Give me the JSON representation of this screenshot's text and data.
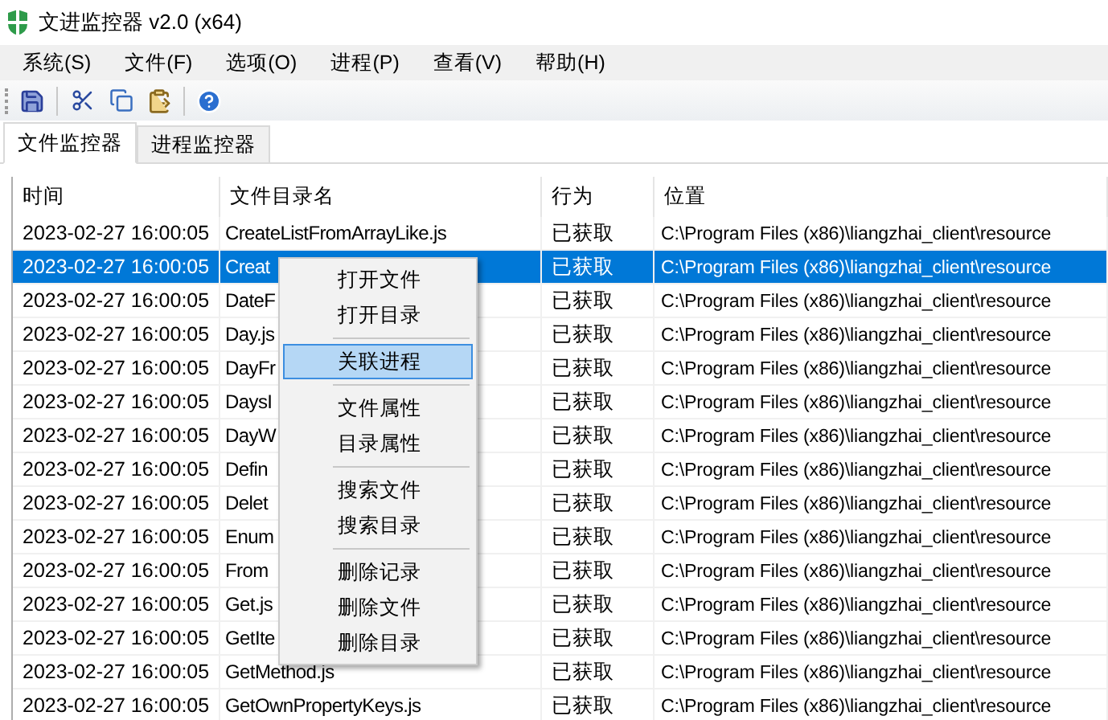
{
  "window": {
    "title": "文进监控器 v2.0 (x64)"
  },
  "menu_bar": [
    "系统(S)",
    "文件(F)",
    "选项(O)",
    "进程(P)",
    "查看(V)",
    "帮助(H)"
  ],
  "tabs": [
    {
      "label": "文件监控器",
      "selected": true
    },
    {
      "label": "进程监控器",
      "selected": false
    }
  ],
  "table": {
    "columns": [
      "时间",
      "文件目录名",
      "行为",
      "位置"
    ],
    "rows": [
      {
        "time": "2023-02-27 16:00:05",
        "name": "CreateListFromArrayLike.js",
        "action": "已获取",
        "location": "C:\\Program Files (x86)\\liangzhai_client\\resource",
        "selected": false
      },
      {
        "time": "2023-02-27 16:00:05",
        "name": "Creat",
        "action": "已获取",
        "location": "C:\\Program Files (x86)\\liangzhai_client\\resource",
        "selected": true
      },
      {
        "time": "2023-02-27 16:00:05",
        "name": "DateF",
        "action": "已获取",
        "location": "C:\\Program Files (x86)\\liangzhai_client\\resource",
        "selected": false
      },
      {
        "time": "2023-02-27 16:00:05",
        "name": "Day.js",
        "action": "已获取",
        "location": "C:\\Program Files (x86)\\liangzhai_client\\resource",
        "selected": false
      },
      {
        "time": "2023-02-27 16:00:05",
        "name": "DayFr",
        "action": "已获取",
        "location": "C:\\Program Files (x86)\\liangzhai_client\\resource",
        "selected": false
      },
      {
        "time": "2023-02-27 16:00:05",
        "name": "DaysI",
        "action": "已获取",
        "location": "C:\\Program Files (x86)\\liangzhai_client\\resource",
        "selected": false
      },
      {
        "time": "2023-02-27 16:00:05",
        "name": "DayW",
        "action": "已获取",
        "location": "C:\\Program Files (x86)\\liangzhai_client\\resource",
        "selected": false
      },
      {
        "time": "2023-02-27 16:00:05",
        "name": "Defin",
        "action": "已获取",
        "location": "C:\\Program Files (x86)\\liangzhai_client\\resource",
        "selected": false
      },
      {
        "time": "2023-02-27 16:00:05",
        "name": "Delet",
        "action": "已获取",
        "location": "C:\\Program Files (x86)\\liangzhai_client\\resource",
        "selected": false
      },
      {
        "time": "2023-02-27 16:00:05",
        "name": "Enum",
        "action": "已获取",
        "location": "C:\\Program Files (x86)\\liangzhai_client\\resource",
        "selected": false
      },
      {
        "time": "2023-02-27 16:00:05",
        "name": "From",
        "action": "已获取",
        "location": "C:\\Program Files (x86)\\liangzhai_client\\resource",
        "selected": false
      },
      {
        "time": "2023-02-27 16:00:05",
        "name": "Get.js",
        "action": "已获取",
        "location": "C:\\Program Files (x86)\\liangzhai_client\\resource",
        "selected": false
      },
      {
        "time": "2023-02-27 16:00:05",
        "name": "GetIte",
        "action": "已获取",
        "location": "C:\\Program Files (x86)\\liangzhai_client\\resource",
        "selected": false
      },
      {
        "time": "2023-02-27 16:00:05",
        "name": "GetMethod.js",
        "action": "已获取",
        "location": "C:\\Program Files (x86)\\liangzhai_client\\resource",
        "selected": false
      },
      {
        "time": "2023-02-27 16:00:05",
        "name": "GetOwnPropertyKeys.js",
        "action": "已获取",
        "location": "C:\\Program Files (x86)\\liangzhai_client\\resource",
        "selected": false
      }
    ]
  },
  "context_menu": [
    {
      "kind": "item",
      "label": "打开文件",
      "selected": false
    },
    {
      "kind": "item",
      "label": "打开目录",
      "selected": false
    },
    {
      "kind": "separator"
    },
    {
      "kind": "item",
      "label": "关联进程",
      "selected": true
    },
    {
      "kind": "separator"
    },
    {
      "kind": "item",
      "label": "文件属性",
      "selected": false
    },
    {
      "kind": "item",
      "label": "目录属性",
      "selected": false
    },
    {
      "kind": "separator"
    },
    {
      "kind": "item",
      "label": "搜索文件",
      "selected": false
    },
    {
      "kind": "item",
      "label": "搜索目录",
      "selected": false
    },
    {
      "kind": "separator"
    },
    {
      "kind": "item",
      "label": "删除记录",
      "selected": false
    },
    {
      "kind": "item",
      "label": "删除文件",
      "selected": false
    },
    {
      "kind": "item",
      "label": "删除目录",
      "selected": false
    }
  ]
}
